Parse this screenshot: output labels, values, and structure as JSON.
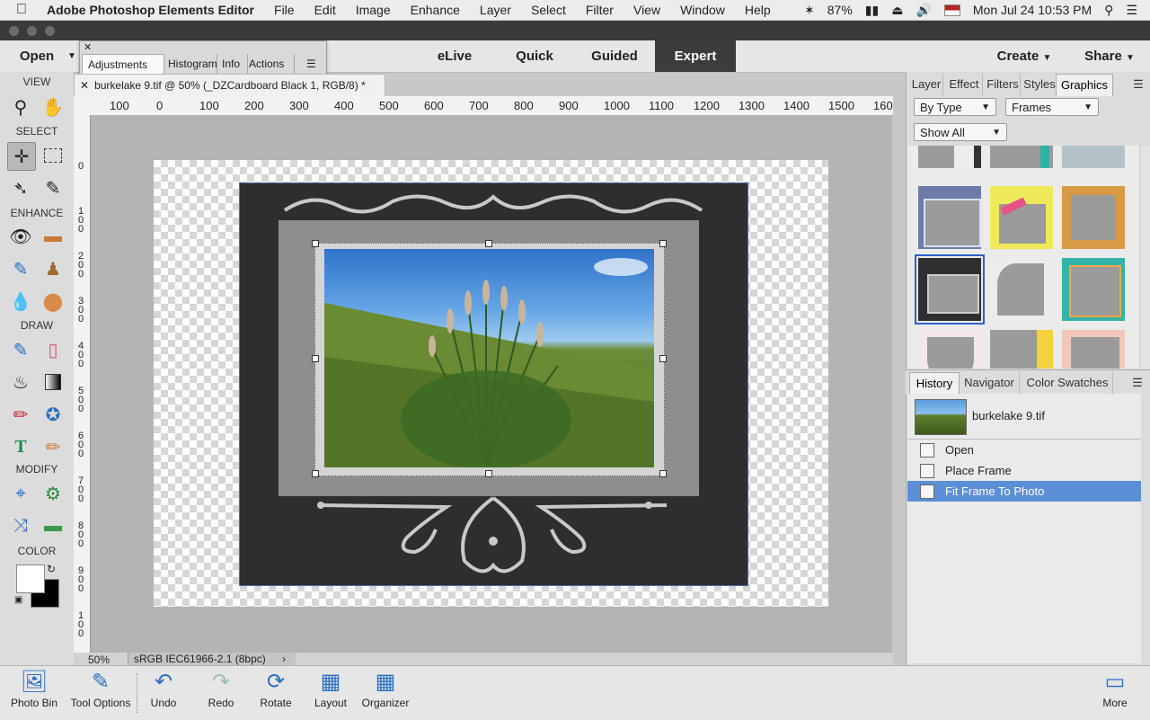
{
  "menubar": {
    "app_name": "Adobe Photoshop Elements Editor",
    "items": [
      "File",
      "Edit",
      "Image",
      "Enhance",
      "Layer",
      "Select",
      "Filter",
      "View",
      "Window",
      "Help"
    ],
    "battery": "87%",
    "datetime": "Mon Jul 24  10:53 PM"
  },
  "topbar": {
    "open_label": "Open",
    "modes": [
      "eLive",
      "Quick",
      "Guided",
      "Expert"
    ],
    "active_mode": "Expert",
    "create_label": "Create",
    "share_label": "Share"
  },
  "float_panel": {
    "tabs": [
      "Adjustments",
      "Histogram",
      "Info",
      "Actions"
    ]
  },
  "toolbox": {
    "sections": [
      "VIEW",
      "SELECT",
      "ENHANCE",
      "DRAW",
      "MODIFY",
      "COLOR"
    ]
  },
  "document": {
    "tab_title": "burkelake 9.tif @ 50% (_DZCardboard Black 1, RGB/8) *",
    "zoom": "50%",
    "color_profile": "sRGB IEC61966-2.1 (8bpc)"
  },
  "ruler": {
    "h_labels": [
      "100",
      "0",
      "100",
      "200",
      "300",
      "400",
      "500",
      "600",
      "700",
      "800",
      "900",
      "1000",
      "1100",
      "1200",
      "1300",
      "1400",
      "1500",
      "160"
    ],
    "v_labels": [
      "0",
      "100",
      "200",
      "300",
      "400",
      "500",
      "600",
      "700",
      "800",
      "900",
      "100"
    ]
  },
  "right_panel": {
    "tabs": [
      "Layer",
      "Effect",
      "Filters",
      "Styles",
      "Graphics"
    ],
    "active_tab": "Graphics",
    "by_type": "By Type",
    "category": "Frames",
    "show_all": "Show All"
  },
  "history_panel": {
    "tabs": [
      "History",
      "Navigator",
      "Color Swatches"
    ],
    "file": "burkelake 9.tif",
    "items": [
      "Open",
      "Place Frame",
      "Fit Frame To Photo"
    ],
    "selected": "Fit Frame To Photo"
  },
  "bottombar": {
    "items": [
      "Photo Bin",
      "Tool Options",
      "Undo",
      "Redo",
      "Rotate",
      "Layout",
      "Organizer"
    ],
    "more_label": "More"
  }
}
